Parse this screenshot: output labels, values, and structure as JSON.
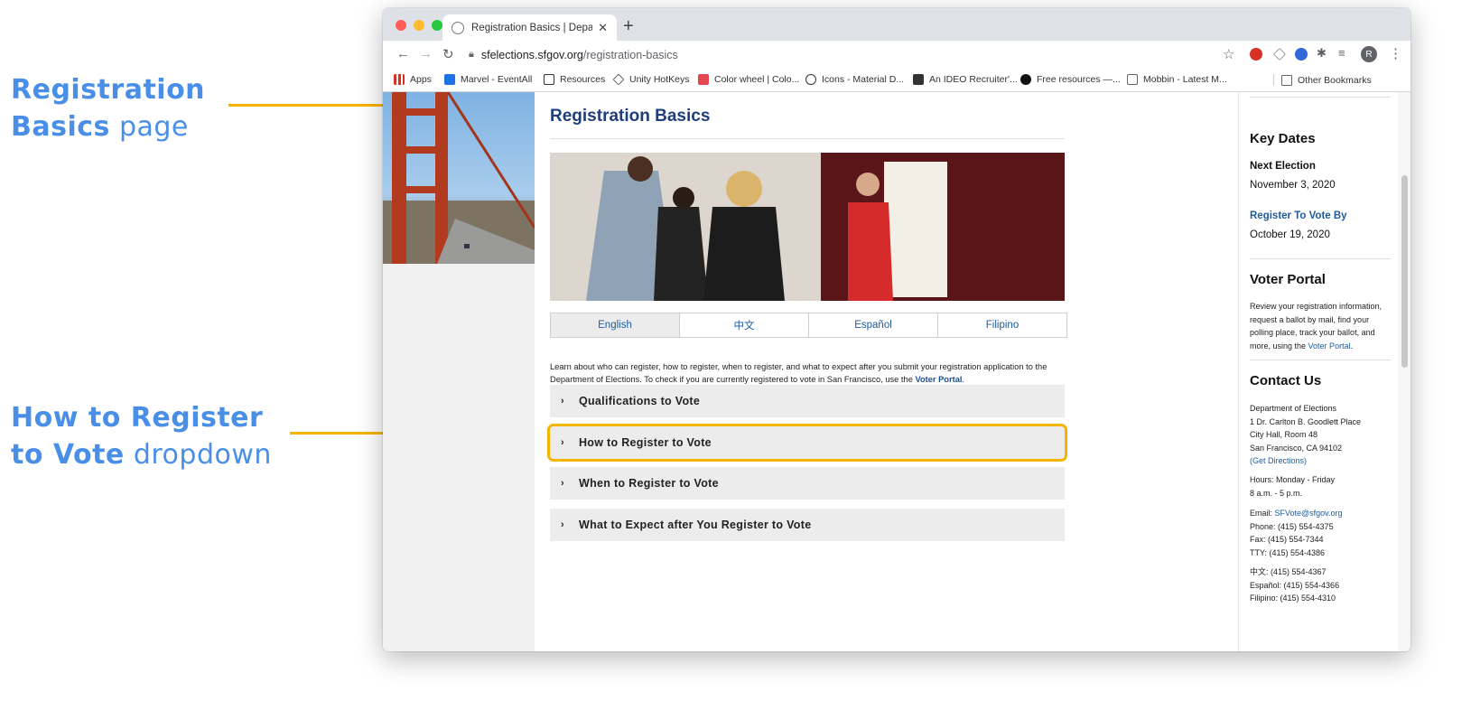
{
  "annotations": {
    "first": {
      "bold1": "Registration",
      "bold2": "Basics",
      "light": "page"
    },
    "second": {
      "bold1": "How to Register",
      "bold2": "to Vote",
      "light": "dropdown"
    }
  },
  "colors": {
    "annotation": "#4a8fe7",
    "highlight": "#f5b400",
    "title_blue": "#1f3d7a"
  },
  "browser": {
    "tab_title": "Registration Basics | Departme",
    "url_domain": "sfelections.sfgov.org",
    "url_path": "/registration-basics",
    "profile_initial": "R",
    "bookmarks": [
      {
        "label": "Apps",
        "icon": "apps-grid-icon"
      },
      {
        "label": "Marvel - EventAll",
        "icon": "marvel-icon"
      },
      {
        "label": "Resources",
        "icon": "notion-icon"
      },
      {
        "label": "Unity HotKeys",
        "icon": "unity-icon"
      },
      {
        "label": "Color wheel | Colo...",
        "icon": "adobe-icon"
      },
      {
        "label": "Icons - Material D...",
        "icon": "material-icon"
      },
      {
        "label": "An IDEO Recruiter'...",
        "icon": "ideo-icon"
      },
      {
        "label": "Free resources —...",
        "icon": "dot-icon"
      },
      {
        "label": "Mobbin - Latest M...",
        "icon": "mobbin-icon"
      },
      {
        "label": "Other Bookmarks",
        "icon": "folder-icon"
      }
    ]
  },
  "page": {
    "title": "Registration Basics",
    "languages": [
      "English",
      "中文",
      "Español",
      "Filipino"
    ],
    "intro_text": "Learn about who can register, how to register, when to register, and what to expect after you submit your registration application to the Department of Elections. To check if you are currently registered to vote in San Francisco, use the ",
    "intro_link": "Voter Portal",
    "intro_end": ".",
    "accordions": [
      "Qualifications to Vote",
      "How to Register to Vote",
      "When to Register to Vote",
      "What to Expect after You Register to Vote"
    ]
  },
  "sidebar": {
    "key_dates_title": "Key Dates",
    "next_election_label": "Next Election",
    "next_election_date": "November 3, 2020",
    "register_by_label": "Register To Vote By",
    "register_by_date": "October 19, 2020",
    "voter_portal_title": "Voter Portal",
    "voter_portal_text": "Review your registration information, request a ballot by mail, find your polling place, track your ballot, and more, using the ",
    "voter_portal_link": "Voter Portal",
    "contact_title": "Contact Us",
    "address": [
      "Department of Elections",
      "1 Dr. Carlton B. Goodlett Place",
      "City Hall, Room 48",
      "San Francisco, CA 94102"
    ],
    "directions_link": "(Get Directions)",
    "hours": [
      "Hours: Monday - Friday",
      "8 a.m. - 5 p.m."
    ],
    "email_label": "Email: ",
    "email": "SFVote@sfgov.org",
    "phones": [
      "Phone: (415) 554-4375",
      "Fax: (415) 554-7344",
      "TTY: (415) 554-4386"
    ],
    "language_lines": [
      "中文: (415) 554-4367",
      "Español: (415) 554-4366",
      "Filipino: (415) 554-4310"
    ]
  }
}
